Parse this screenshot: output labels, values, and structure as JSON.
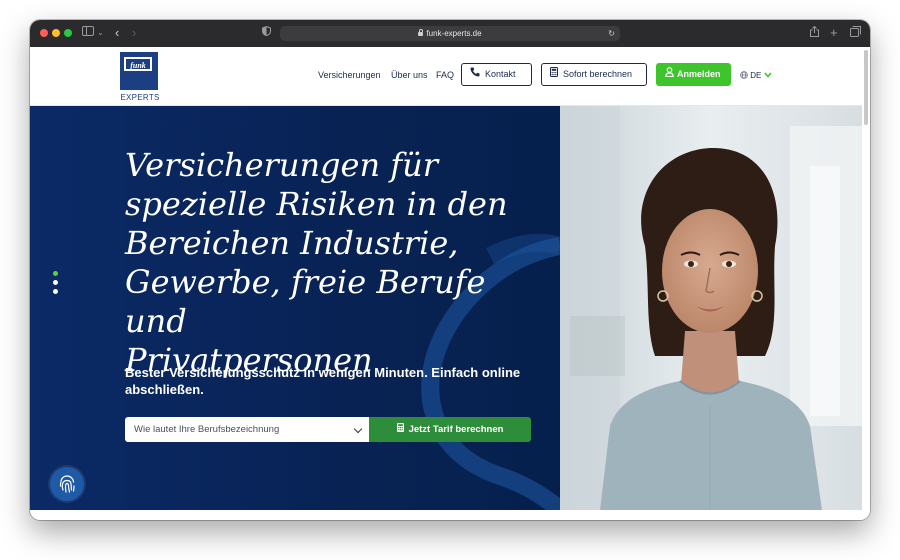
{
  "browser": {
    "url": "funk-experts.de"
  },
  "header": {
    "logo_mark": "funk",
    "logo_text": "EXPERTS",
    "nav": [
      "Versicherungen",
      "Über uns",
      "FAQ"
    ],
    "contact_label": "Kontakt",
    "calc_label": "Sofort berechnen",
    "login_label": "Anmelden",
    "language": "DE"
  },
  "hero": {
    "headline_lines": [
      "Versicherungen für",
      "spezielle Risiken in den",
      "Bereichen Industrie,",
      "Gewerbe, freie Berufe und",
      "Privatpersonen"
    ],
    "subline": "Bester Versicherungsschutz in wenigen Minuten. Einfach online abschließen.",
    "select_placeholder": "Wie lautet Ihre Berufsbezeichnung",
    "cta_label": "Jetzt Tarif berechnen"
  },
  "colors": {
    "brand_blue": "#1c3f83",
    "hero_bg": "#0b2a66",
    "green": "#3fc52c",
    "cta_green": "#2e8d3a"
  },
  "icons": [
    "sidebar-icon",
    "back-icon",
    "forward-icon",
    "shield-icon",
    "lock-icon",
    "reload-icon",
    "share-icon",
    "new-tab-icon",
    "tabs-icon",
    "phone-icon",
    "calculator-icon",
    "user-icon",
    "globe-icon",
    "chevron-down-icon",
    "fingerprint-icon"
  ]
}
